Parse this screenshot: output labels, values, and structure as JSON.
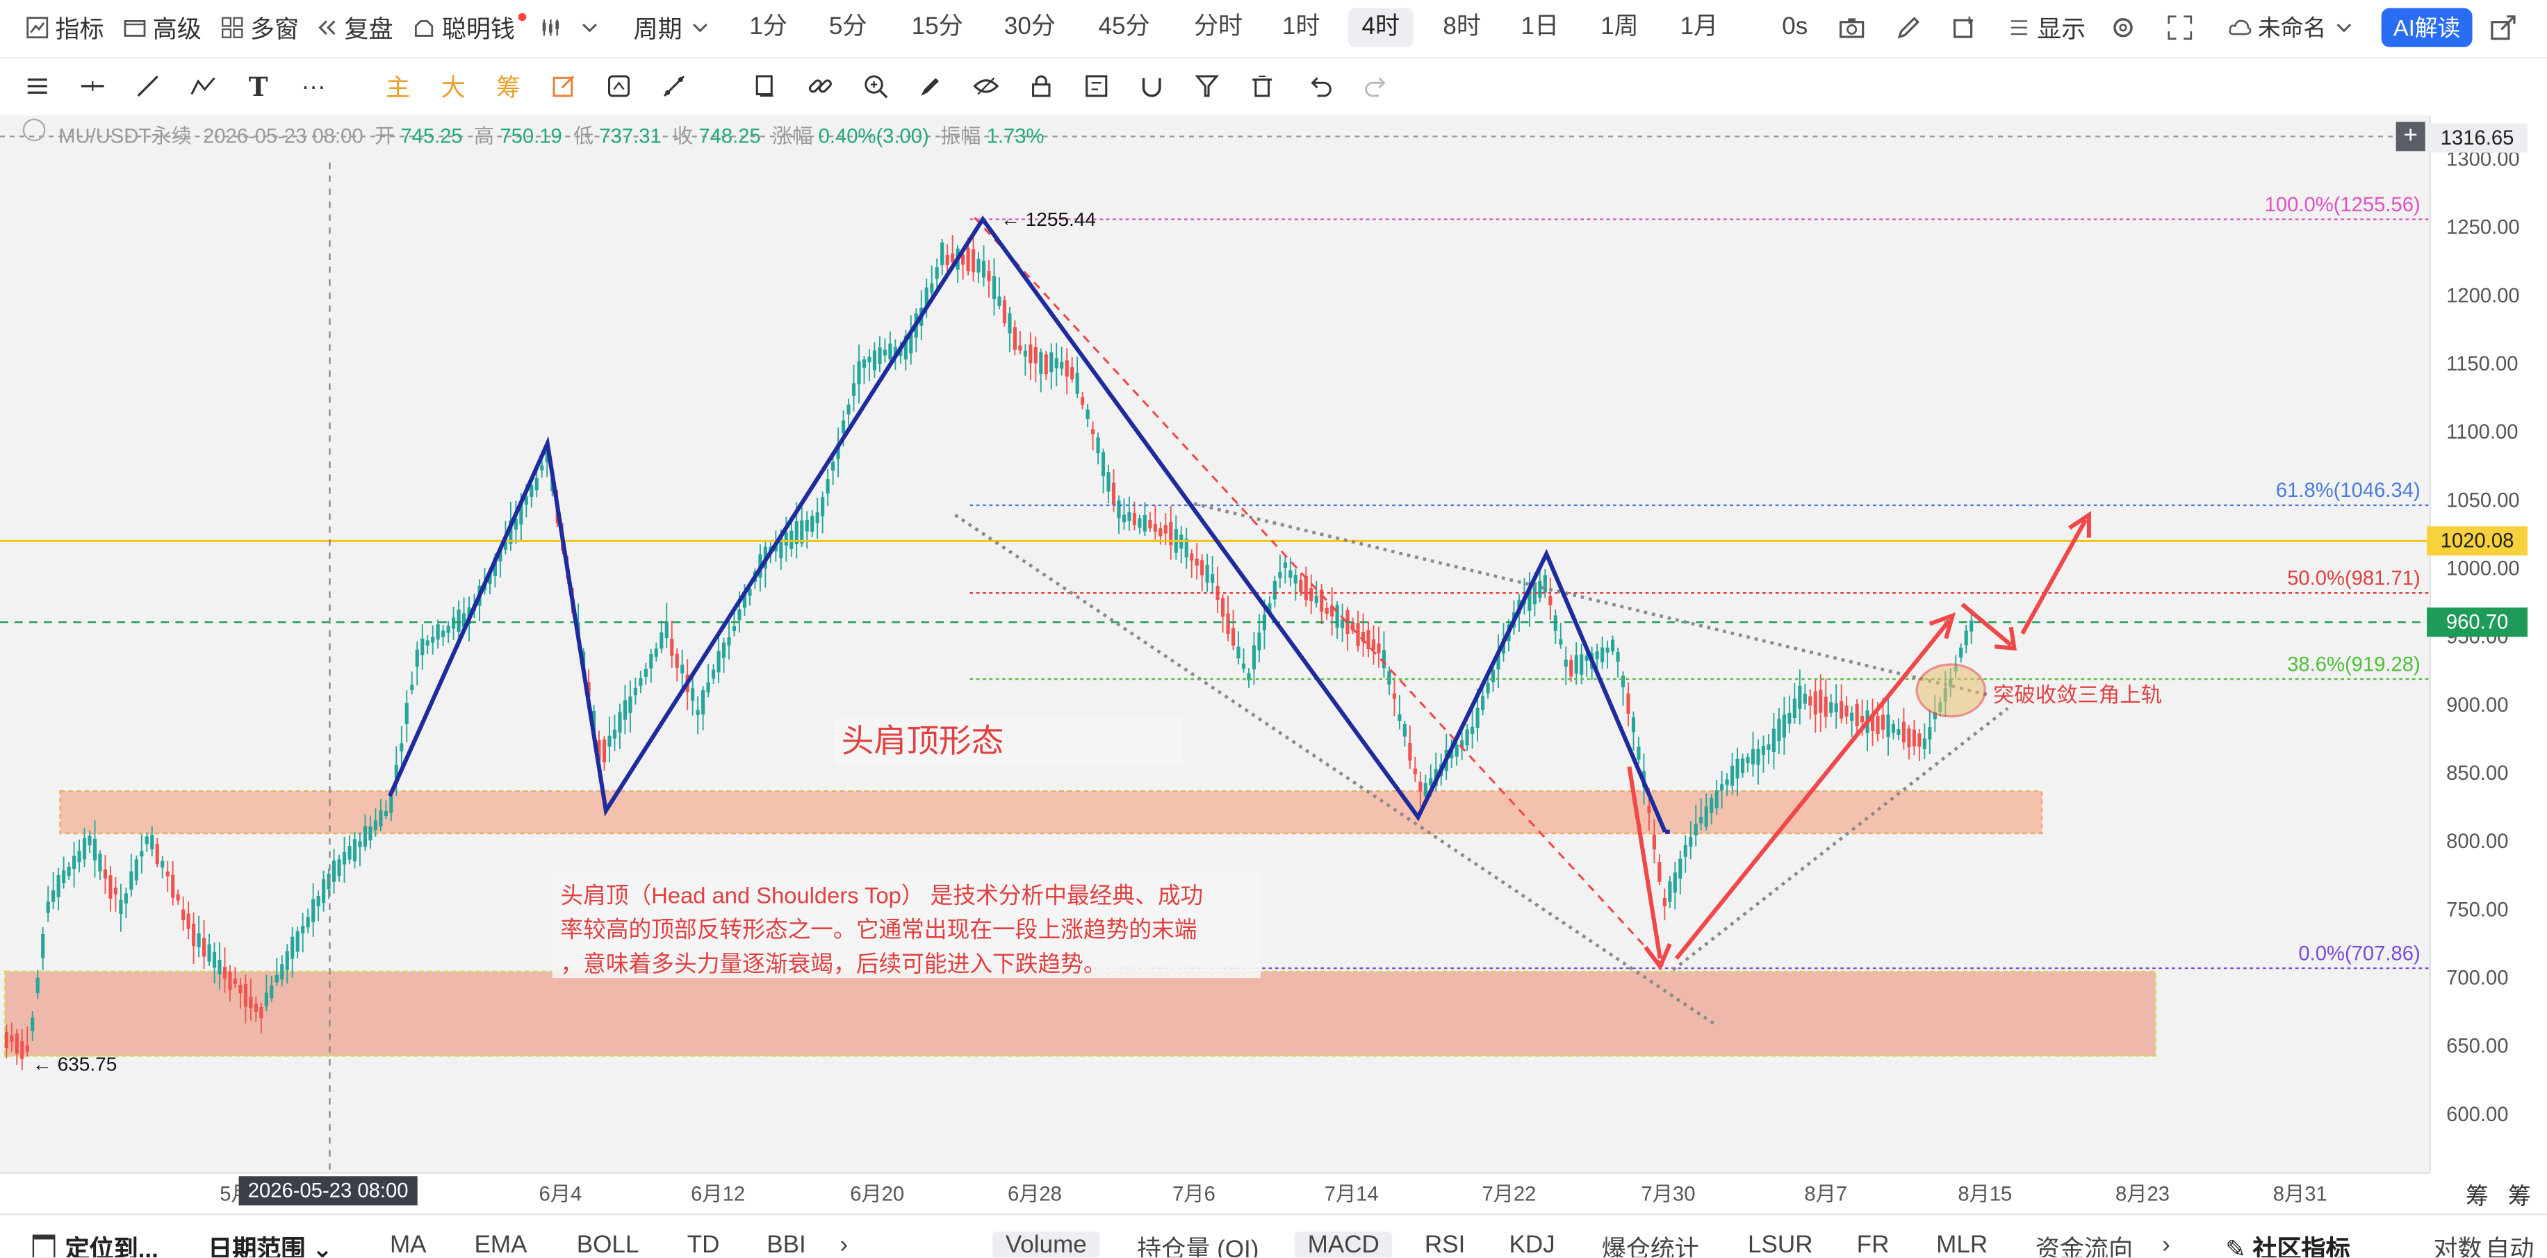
{
  "topbar": {
    "indicators_label": "指标",
    "advanced_label": "高级",
    "multiwindow_label": "多窗",
    "replay_label": "复盘",
    "smartmoney_label": "聪明钱",
    "period_label": "周期",
    "periods": [
      "1分",
      "5分",
      "15分",
      "30分",
      "45分",
      "分时",
      "1时",
      "4时",
      "8时",
      "1日",
      "1周",
      "1月"
    ],
    "active_period": "4时",
    "countdown": "0s",
    "display_label": "显示",
    "unnamed_label": "未命名",
    "ai_button": "AI解读"
  },
  "drawing_tools": {
    "main_label": "主",
    "big_label": "大",
    "chip_label": "筹"
  },
  "ohlc": {
    "symbol": "MU/USDT永续",
    "datetime": "2026-05-23 08:00",
    "open_label": "开",
    "open": "745.25",
    "high_label": "高",
    "high": "750.19",
    "low_label": "低",
    "low": "737.31",
    "close_label": "收",
    "close": "748.25",
    "change_label": "涨幅",
    "change": "0.40%(3.00)",
    "amplitude_label": "振幅",
    "amplitude": "1.73%"
  },
  "price_axis": {
    "top_value": "1316.65",
    "ticks": [
      "1300.00",
      "1250.00",
      "1200.00",
      "1150.00",
      "1100.00",
      "1050.00",
      "1000.00",
      "950.00",
      "900.00",
      "850.00",
      "800.00",
      "750.00",
      "700.00",
      "650.00",
      "600.00"
    ],
    "yellow_line_label": "1020.08",
    "current_price": "960.70",
    "axis_mode_label": "筹",
    "auto_label": "自动",
    "log_label": "对数"
  },
  "time_axis": {
    "labels": [
      "5月",
      "6月4",
      "6月12",
      "6月20",
      "6月28",
      "7月6",
      "7月14",
      "7月22",
      "7月30",
      "8月7",
      "8月15",
      "8月23",
      "8月31"
    ],
    "crosshair_date": "2026-05-23 08:00"
  },
  "annotations": {
    "high_mark": "1255.44",
    "low_mark": "635.75",
    "fib_100": "100.0%(1255.56)",
    "fib_618": "61.8%(1046.34)",
    "fib_50": "50.0%(981.71)",
    "fib_386": "38.6%(919.28)",
    "fib_0": "0.0%(707.86)",
    "pattern_title": "头肩顶形态",
    "breakout_note": "突破收敛三角上轨",
    "description_lines": [
      "头肩顶（Head and Shoulders Top） 是技术分析中最经典、成功",
      "率较高的顶部反转形态之一。它通常出现在一段上涨趋势的末端",
      "，意味着多头力量逐渐衰竭，后续可能进入下跌趋势。"
    ]
  },
  "bottombar": {
    "locate_label": "定位到...",
    "date_range_label": "日期范围",
    "main_indicators": [
      "MA",
      "EMA",
      "BOLL",
      "TD",
      "BBI"
    ],
    "sub_indicators": [
      "Volume",
      "持仓量 (OI)",
      "MACD",
      "RSI",
      "KDJ",
      "爆仓统计",
      "LSUR",
      "FR",
      "MLR",
      "资金流向"
    ],
    "selected_sub": [
      "Volume",
      "MACD"
    ],
    "community_label": "社区指标"
  },
  "colors": {
    "bull": "#26a69a",
    "bear": "#ef5350",
    "pattern_line": "#1e2b9e",
    "arrow": "#f04848",
    "zone_fill": "#f4b9a6",
    "ai_blue": "#2a6df5",
    "yellow_line": "#f2c418",
    "current_price_bg": "#1e9b58"
  }
}
